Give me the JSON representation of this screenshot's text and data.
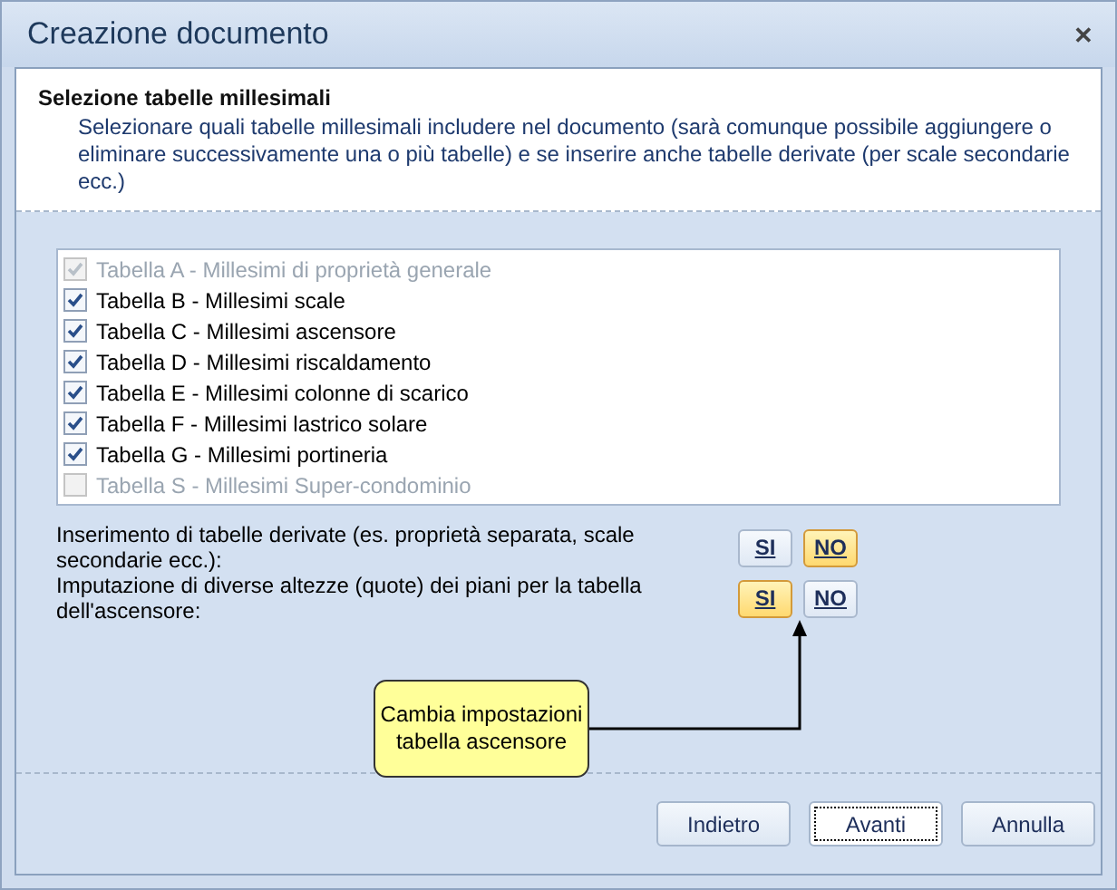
{
  "window": {
    "title": "Creazione documento",
    "close": "✕"
  },
  "header": {
    "title": "Selezione tabelle millesimali",
    "description": "Selezionare quali tabelle millesimali includere nel documento (sarà comunque possibile aggiungere o eliminare successivamente una o più tabelle) e se inserire anche tabelle derivate (per scale secondarie ecc.)"
  },
  "tables": [
    {
      "label": "Tabella A - Millesimi di proprietà generale",
      "checked": true,
      "disabled": true
    },
    {
      "label": "Tabella B - Millesimi scale",
      "checked": true,
      "disabled": false
    },
    {
      "label": "Tabella C - Millesimi ascensore",
      "checked": true,
      "disabled": false
    },
    {
      "label": "Tabella D - Millesimi riscaldamento",
      "checked": true,
      "disabled": false
    },
    {
      "label": "Tabella E - Millesimi colonne di scarico",
      "checked": true,
      "disabled": false
    },
    {
      "label": "Tabella F - Millesimi lastrico solare",
      "checked": true,
      "disabled": false
    },
    {
      "label": "Tabella G - Millesimi portineria",
      "checked": true,
      "disabled": false
    },
    {
      "label": "Tabella S - Millesimi Super-condominio",
      "checked": false,
      "disabled": true
    }
  ],
  "options": [
    {
      "label": "Inserimento di tabelle derivate (es. proprietà separata, scale secondarie ecc.):",
      "choices": [
        {
          "label": "SI",
          "selected": false
        },
        {
          "label": "NO",
          "selected": true
        }
      ]
    },
    {
      "label": "Imputazione di diverse altezze (quote) dei piani per la tabella dell'ascensore:",
      "choices": [
        {
          "label": "SI",
          "selected": true
        },
        {
          "label": "NO",
          "selected": false
        }
      ]
    }
  ],
  "callout": {
    "text": "Cambia impostazioni tabella ascensore"
  },
  "buttons": [
    {
      "label": "Indietro",
      "focused": false
    },
    {
      "label": "Avanti",
      "focused": true
    },
    {
      "label": "Annulla",
      "focused": false
    }
  ]
}
